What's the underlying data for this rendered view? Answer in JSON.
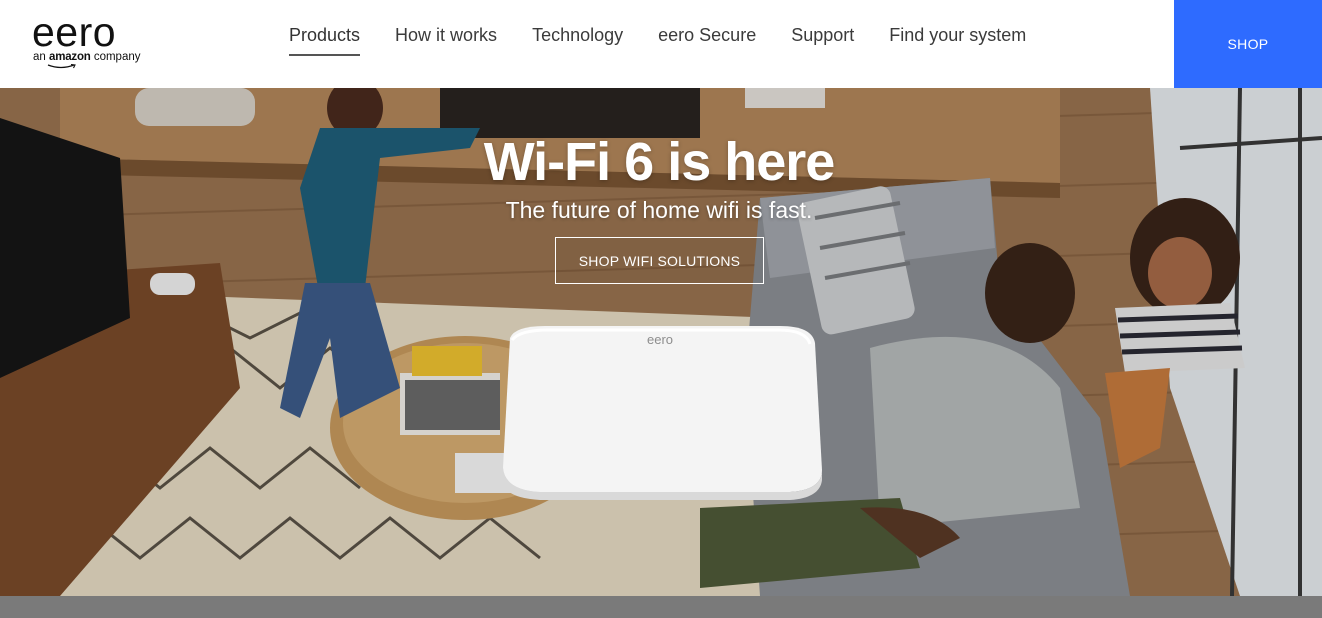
{
  "header": {
    "logo_word": "eero",
    "logo_tag_prefix": "an ",
    "logo_tag_brand": "amazon",
    "logo_tag_suffix": " company",
    "nav": [
      {
        "label": "Products"
      },
      {
        "label": "How it works"
      },
      {
        "label": "Technology"
      },
      {
        "label": "eero Secure"
      },
      {
        "label": "Support"
      },
      {
        "label": "Find your system"
      }
    ],
    "active_nav": "Products",
    "shop_label": "SHOP"
  },
  "hero": {
    "title": "Wi-Fi 6 is here",
    "subtitle": "The future of home wifi is fast.",
    "cta_label": "SHOP WIFI SOLUTIONS",
    "device_logo": "eero"
  },
  "colors": {
    "accent": "#2e6bff",
    "bottom_bar": "#7a7a7a"
  }
}
